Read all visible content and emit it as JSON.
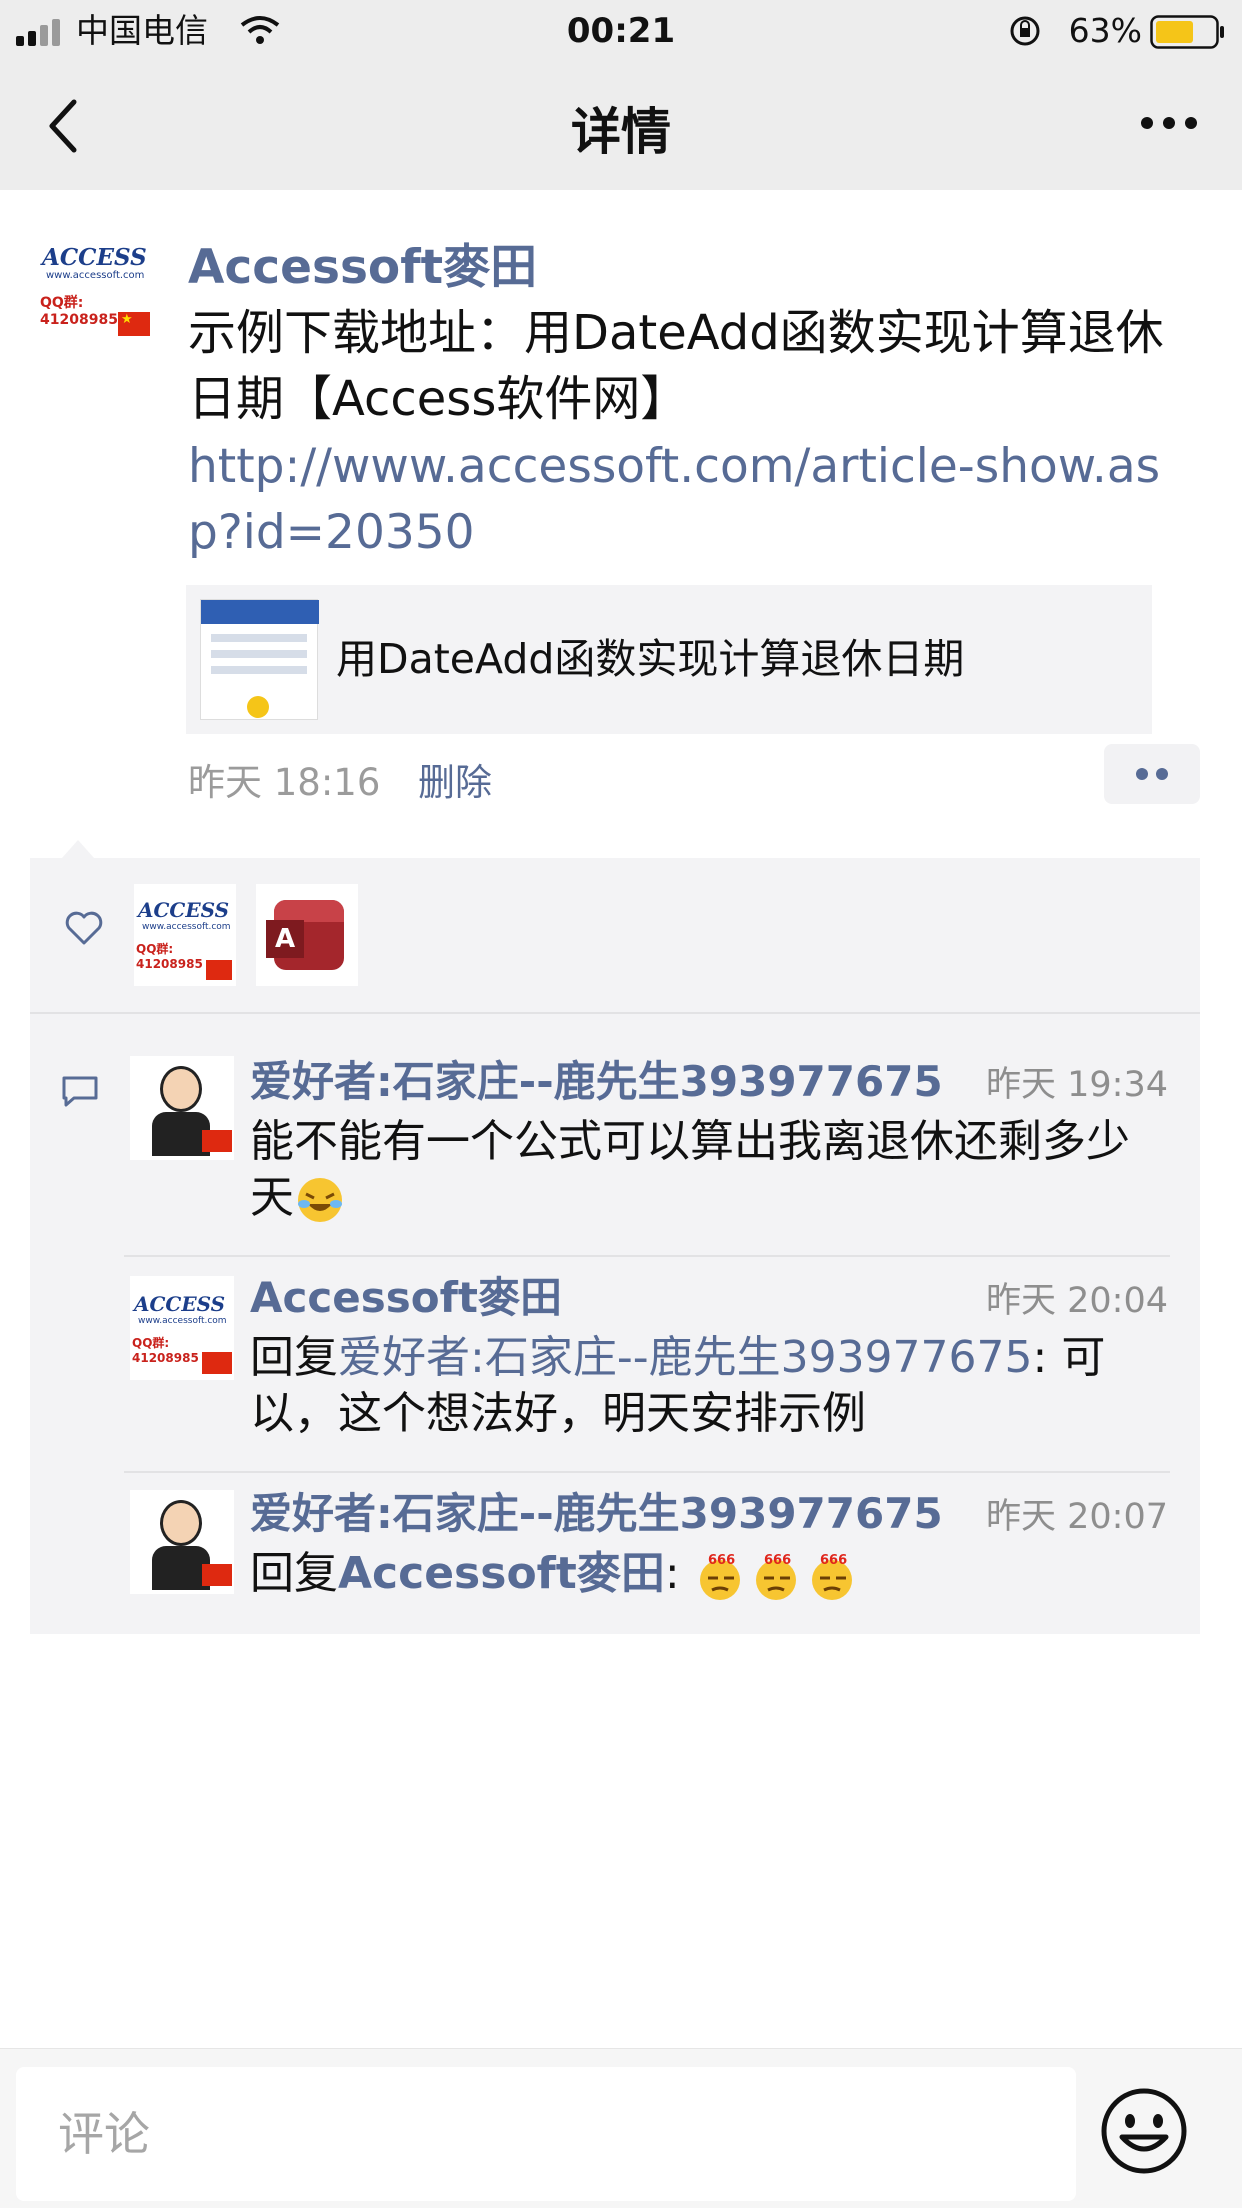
{
  "status": {
    "carrier": "中国电信",
    "time": "00:21",
    "battery": "63%"
  },
  "nav": {
    "title": "详情"
  },
  "post": {
    "author": "Accessoft麥田",
    "text": "示例下载地址：用DateAdd函数实现计算退休日期【Access软件网】",
    "url": "http://www.accessoft.com/article-show.asp?id=20350",
    "link_title": "用DateAdd函数实现计算退休日期",
    "time": "昨天 18:16",
    "delete_label": "删除"
  },
  "avatar_logo": {
    "word": "ACCESS",
    "site": "www.accessoft.com",
    "qq": "QQ群: 41208985"
  },
  "comments": [
    {
      "author": "爱好者:石家庄--鹿先生393977675",
      "time": "昨天 19:34",
      "text": "能不能有一个公式可以算出我离退休还剩多少天"
    },
    {
      "author": "Accessoft麥田",
      "time": "昨天 20:04",
      "reply_prefix": "回复",
      "reply_to": "爱好者:石家庄--鹿先生393977675",
      "text": ": 可以，这个想法好，明天安排示例"
    },
    {
      "author": "爱好者:石家庄--鹿先生393977675",
      "time": "昨天 20:07",
      "reply_prefix": "回复",
      "reply_to": "Accessoft麥田",
      "text": ": "
    }
  ],
  "comment_input": {
    "placeholder": "评论"
  },
  "icons": [
    "signal-icon",
    "wifi-icon",
    "rotation-lock-icon",
    "battery-icon",
    "back-icon",
    "more-icon",
    "heart-icon",
    "comment-icon",
    "emoji-icon",
    "crying-laughing-emoji",
    "666-emoji"
  ],
  "colors": {
    "nickname": "#576b95",
    "panel": "#f3f3f5",
    "bar": "#ededed",
    "battery": "#f5c518"
  }
}
